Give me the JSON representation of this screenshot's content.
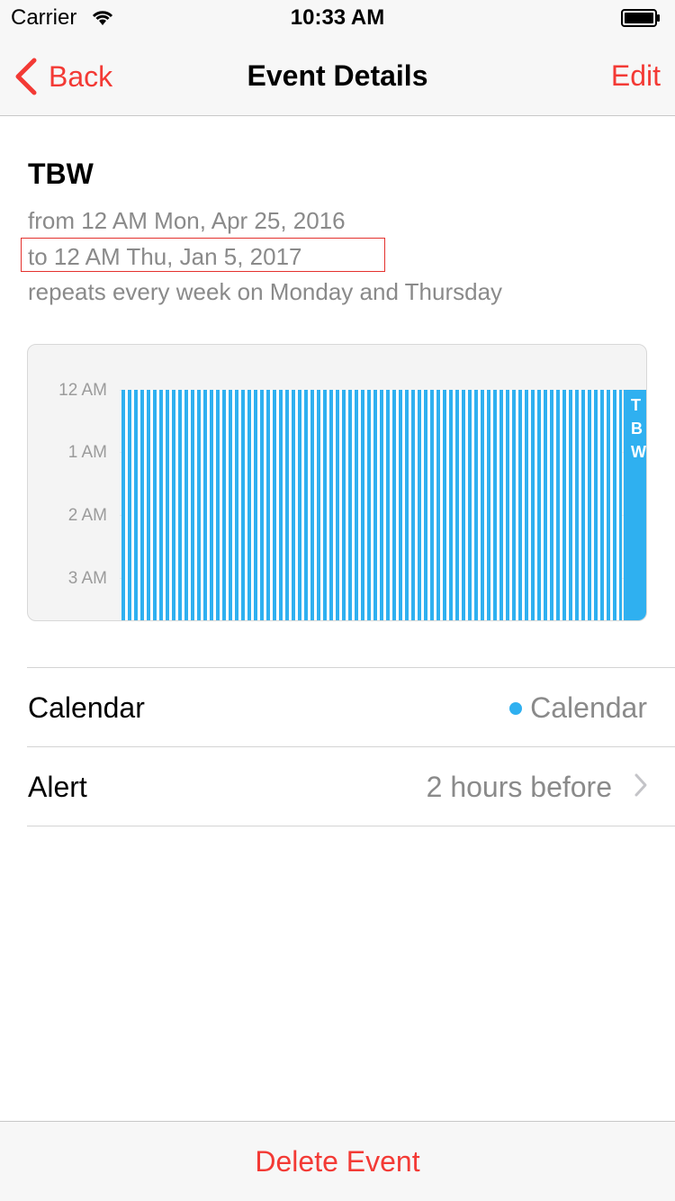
{
  "status_bar": {
    "carrier": "Carrier",
    "time": "10:33 AM",
    "wifi_icon": "wifi-icon",
    "battery_icon": "battery-icon"
  },
  "nav": {
    "back_label": "Back",
    "back_icon": "chevron-left-icon",
    "title": "Event Details",
    "edit_label": "Edit"
  },
  "event": {
    "title": "TBW",
    "from": "from 12 AM Mon, Apr 25, 2016",
    "to": "to 12 AM Thu, Jan 5, 2017",
    "repeat": "repeats every week on Monday and Thursday"
  },
  "day_preview": {
    "hours": [
      "12 AM",
      "1 AM",
      "2 AM",
      "3 AM"
    ],
    "event_label": "TBW"
  },
  "details": {
    "calendar_label": "Calendar",
    "calendar_value": "Calendar",
    "alert_label": "Alert",
    "alert_value": "2 hours before",
    "chevron_icon": "chevron-right-icon"
  },
  "footer": {
    "delete_label": "Delete Event"
  },
  "colors": {
    "accent_red": "#f33a35",
    "event_blue": "#2fb0f0",
    "secondary_text": "#8a8a8a",
    "highlight_border": "#e4322e"
  }
}
